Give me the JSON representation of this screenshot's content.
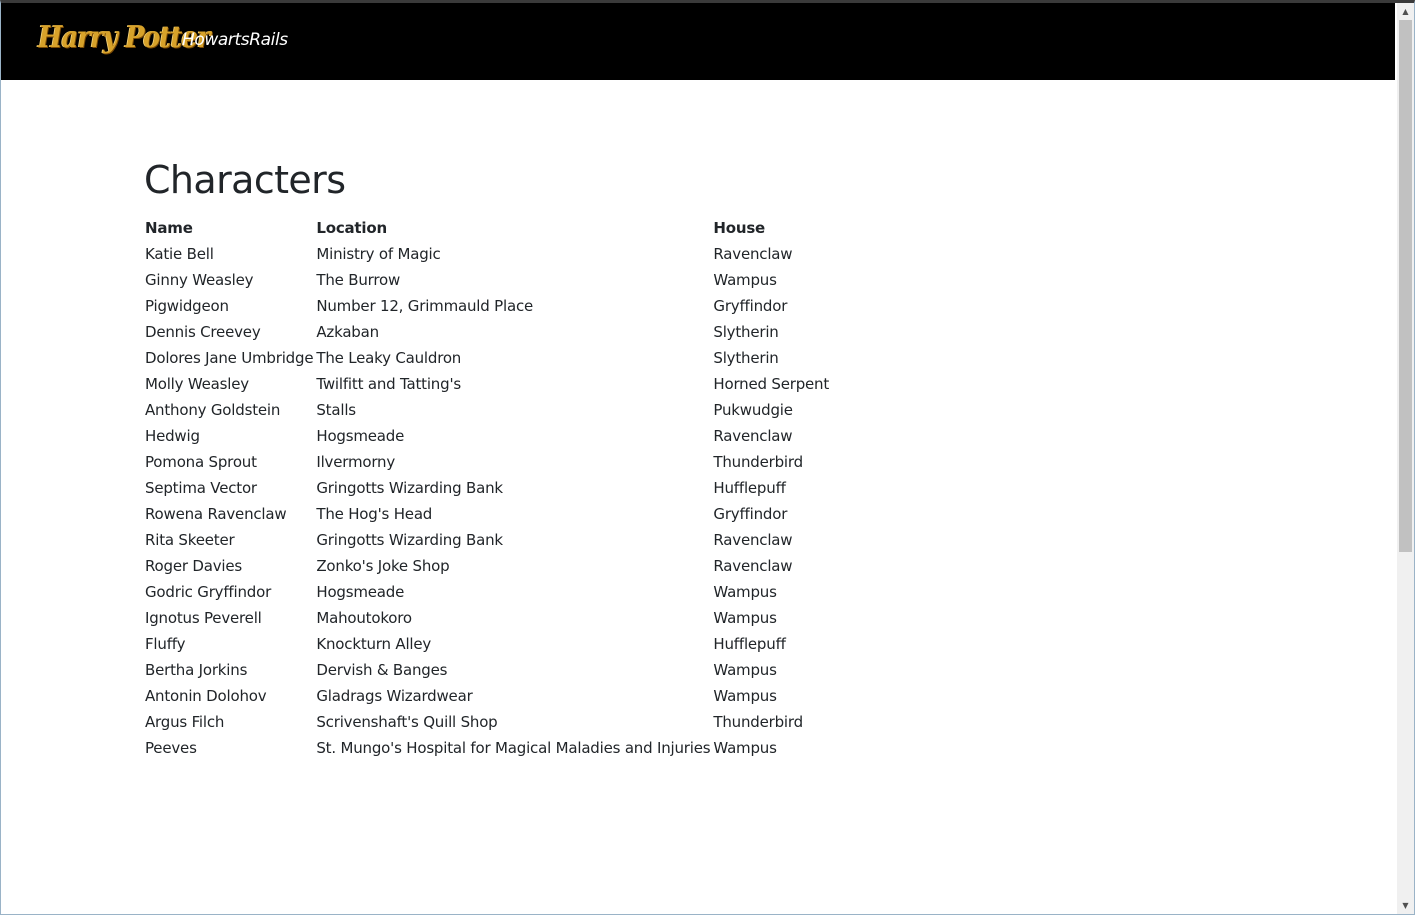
{
  "navbar": {
    "logo_text": "Harry Potter",
    "brand": "HowartsRails"
  },
  "page": {
    "title": "Characters"
  },
  "table": {
    "headers": {
      "name": "Name",
      "location": "Location",
      "house": "House"
    },
    "rows": [
      {
        "name": "Katie Bell",
        "location": "Ministry of Magic",
        "house": "Ravenclaw"
      },
      {
        "name": "Ginny Weasley",
        "location": "The Burrow",
        "house": "Wampus"
      },
      {
        "name": "Pigwidgeon",
        "location": "Number 12, Grimmauld Place",
        "house": "Gryffindor"
      },
      {
        "name": "Dennis Creevey",
        "location": "Azkaban",
        "house": "Slytherin"
      },
      {
        "name": "Dolores Jane Umbridge",
        "location": "The Leaky Cauldron",
        "house": "Slytherin"
      },
      {
        "name": "Molly Weasley",
        "location": "Twilfitt and Tatting's",
        "house": "Horned Serpent"
      },
      {
        "name": "Anthony Goldstein",
        "location": "Stalls",
        "house": "Pukwudgie"
      },
      {
        "name": "Hedwig",
        "location": "Hogsmeade",
        "house": "Ravenclaw"
      },
      {
        "name": "Pomona Sprout",
        "location": "Ilvermorny",
        "house": "Thunderbird"
      },
      {
        "name": "Septima Vector",
        "location": "Gringotts Wizarding Bank",
        "house": "Hufflepuff"
      },
      {
        "name": "Rowena Ravenclaw",
        "location": "The Hog's Head",
        "house": "Gryffindor"
      },
      {
        "name": "Rita Skeeter",
        "location": "Gringotts Wizarding Bank",
        "house": "Ravenclaw"
      },
      {
        "name": "Roger Davies",
        "location": "Zonko's Joke Shop",
        "house": "Ravenclaw"
      },
      {
        "name": "Godric Gryffindor",
        "location": "Hogsmeade",
        "house": "Wampus"
      },
      {
        "name": "Ignotus Peverell",
        "location": "Mahoutokoro",
        "house": "Wampus"
      },
      {
        "name": "Fluffy",
        "location": "Knockturn Alley",
        "house": "Hufflepuff"
      },
      {
        "name": "Bertha Jorkins",
        "location": "Dervish & Banges",
        "house": "Wampus"
      },
      {
        "name": "Antonin Dolohov",
        "location": "Gladrags Wizardwear",
        "house": "Wampus"
      },
      {
        "name": "Argus Filch",
        "location": "Scrivenshaft's Quill Shop",
        "house": "Thunderbird"
      },
      {
        "name": "Peeves",
        "location": "St. Mungo's Hospital for Magical Maladies and Injuries",
        "house": "Wampus"
      }
    ]
  },
  "scrollbar": {
    "up_icon": "scroll-up-arrow-icon",
    "down_icon": "scroll-down-arrow-icon"
  }
}
